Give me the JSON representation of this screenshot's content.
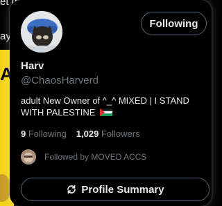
{
  "background": {
    "top_text": "et this post",
    "side_text": "ay",
    "big_letter": "A"
  },
  "profile": {
    "name": "Harv",
    "handle": "@ChaosHarverd",
    "bio": "adult New Owner of ^_^ MIXED | I STAND WITH PALESTINE",
    "bio_flag_icon": "palestine-flag-icon",
    "follow_button_label": "Following",
    "following_count": "9",
    "following_label": "Following",
    "followers_count": "1,029",
    "followers_label": "Followers",
    "followed_by_text": "Followed by MOVED ACCS",
    "summary_button_label": "Profile Summary",
    "summary_icon": "refresh-icon"
  },
  "colors": {
    "card_bg": "#000000",
    "text_primary": "#e7e9ea",
    "text_secondary": "#71767b",
    "border": "#536471",
    "bg_accent": "#f5d31c"
  }
}
